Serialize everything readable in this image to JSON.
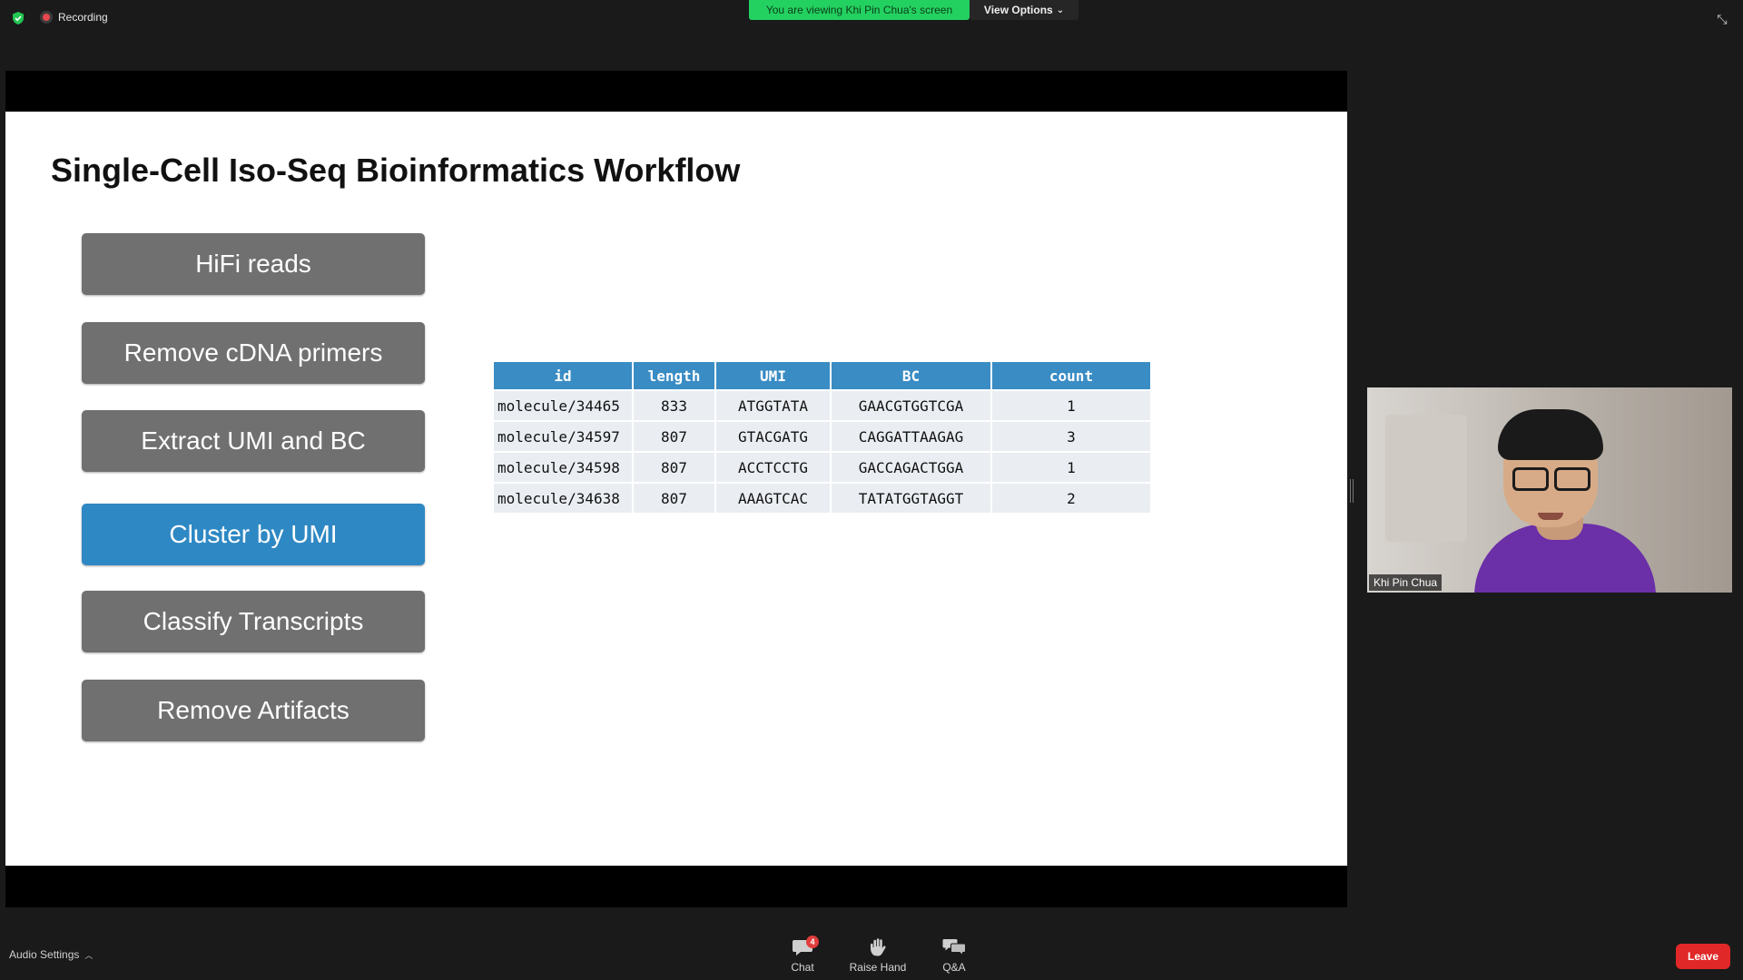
{
  "top_bar": {
    "recording_label": "Recording",
    "viewing_banner": "You are viewing Khi Pin Chua's screen",
    "view_options_label": "View Options"
  },
  "slide": {
    "title": "Single-Cell Iso-Seq Bioinformatics Workflow",
    "steps": [
      {
        "label": "HiFi reads",
        "highlighted": false
      },
      {
        "label": "Remove cDNA primers",
        "highlighted": false
      },
      {
        "label": "Extract UMI and BC",
        "highlighted": false
      },
      {
        "label": "Cluster by UMI",
        "highlighted": true
      },
      {
        "label": "Classify Transcripts",
        "highlighted": false
      },
      {
        "label": "Remove Artifacts",
        "highlighted": false
      }
    ],
    "table": {
      "headers": [
        "id",
        "length",
        "UMI",
        "BC",
        "count"
      ],
      "rows": [
        [
          "molecule/34465",
          "833",
          "ATGGTATA",
          "GAACGTGGTCGA",
          "1"
        ],
        [
          "molecule/34597",
          "807",
          "GTACGATG",
          "CAGGATTAAGAG",
          "3"
        ],
        [
          "molecule/34598",
          "807",
          "ACCTCCTG",
          "GACCAGACTGGA",
          "1"
        ],
        [
          "molecule/34638",
          "807",
          "AAAGTCAC",
          "TATATGGTAGGT",
          "2"
        ]
      ]
    }
  },
  "video": {
    "participant_name": "Khi Pin Chua"
  },
  "bottom_bar": {
    "audio_settings_label": "Audio Settings",
    "chat_label": "Chat",
    "chat_badge": "4",
    "raise_hand_label": "Raise Hand",
    "qa_label": "Q&A",
    "leave_label": "Leave"
  },
  "colors": {
    "banner_green": "#23d160",
    "highlight_blue": "#2e88c3",
    "step_gray": "#707070",
    "leave_red": "#e02828"
  }
}
